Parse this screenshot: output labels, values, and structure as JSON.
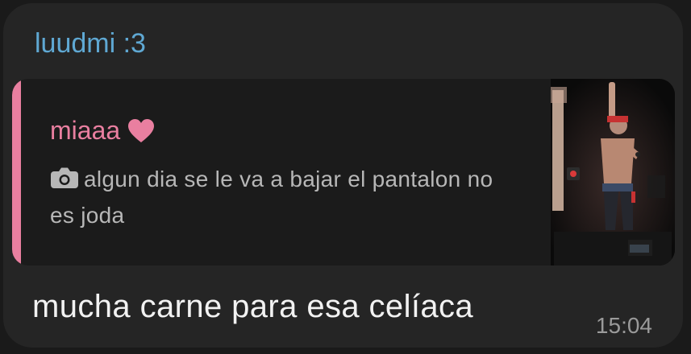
{
  "message": {
    "sender_name": "luudmi :3",
    "text": "mucha carne para esa celíaca",
    "timestamp": "15:04"
  },
  "reply": {
    "author": "miaaa",
    "author_suffix_icon": "heart-icon",
    "media_icon": "camera-icon",
    "text": "algun dia se le va a bajar el pantalon no es joda",
    "thumbnail": "concert-photo"
  },
  "colors": {
    "sender_name": "#5fa8d3",
    "reply_accent": "#e97fa0",
    "bubble_bg": "#252525",
    "quote_bg": "#1b1b1b",
    "text": "#f2f2f2",
    "muted": "#9a9a9a"
  }
}
